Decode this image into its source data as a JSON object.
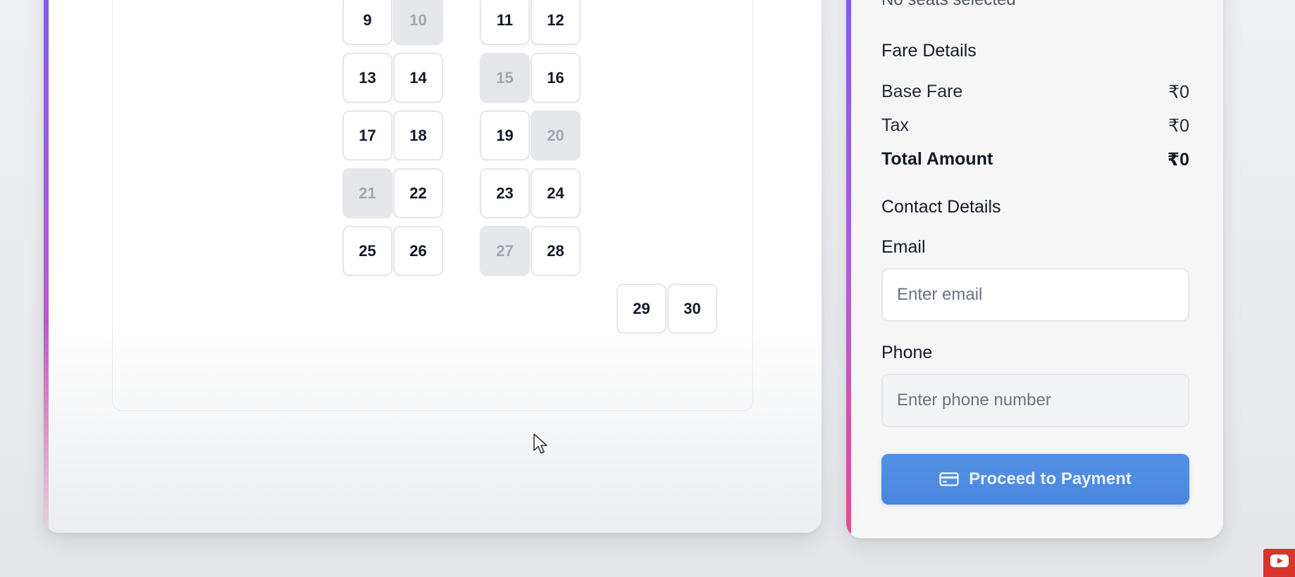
{
  "seat_map": {
    "seats": [
      {
        "number": "",
        "booked": false,
        "col": 0,
        "row": -1
      },
      {
        "number": "",
        "booked": false,
        "col": 1,
        "row": -1
      },
      {
        "number": "",
        "booked": true,
        "col": 2,
        "row": -1
      },
      {
        "number": "",
        "booked": false,
        "col": 3,
        "row": -1
      },
      {
        "number": "9",
        "booked": false,
        "col": 0,
        "row": 0
      },
      {
        "number": "10",
        "booked": true,
        "col": 1,
        "row": 0
      },
      {
        "number": "11",
        "booked": false,
        "col": 2,
        "row": 0
      },
      {
        "number": "12",
        "booked": false,
        "col": 3,
        "row": 0
      },
      {
        "number": "13",
        "booked": false,
        "col": 0,
        "row": 1
      },
      {
        "number": "14",
        "booked": false,
        "col": 1,
        "row": 1
      },
      {
        "number": "15",
        "booked": true,
        "col": 2,
        "row": 1
      },
      {
        "number": "16",
        "booked": false,
        "col": 3,
        "row": 1
      },
      {
        "number": "17",
        "booked": false,
        "col": 0,
        "row": 2
      },
      {
        "number": "18",
        "booked": false,
        "col": 1,
        "row": 2
      },
      {
        "number": "19",
        "booked": false,
        "col": 2,
        "row": 2
      },
      {
        "number": "20",
        "booked": true,
        "col": 3,
        "row": 2
      },
      {
        "number": "21",
        "booked": true,
        "col": 0,
        "row": 3
      },
      {
        "number": "22",
        "booked": false,
        "col": 1,
        "row": 3
      },
      {
        "number": "23",
        "booked": false,
        "col": 2,
        "row": 3
      },
      {
        "number": "24",
        "booked": false,
        "col": 3,
        "row": 3
      },
      {
        "number": "25",
        "booked": false,
        "col": 0,
        "row": 4
      },
      {
        "number": "26",
        "booked": false,
        "col": 1,
        "row": 4
      },
      {
        "number": "27",
        "booked": true,
        "col": 2,
        "row": 4
      },
      {
        "number": "28",
        "booked": false,
        "col": 3,
        "row": 4
      },
      {
        "number": "29",
        "booked": false,
        "col": 4,
        "row": 5
      },
      {
        "number": "30",
        "booked": false,
        "col": 5,
        "row": 5
      }
    ]
  },
  "summary": {
    "selected_text": "No seats selected",
    "fare_title": "Fare Details",
    "fare_rows": [
      {
        "label": "Base Fare",
        "value": "₹0"
      },
      {
        "label": "Tax",
        "value": "₹0"
      },
      {
        "label": "Total Amount",
        "value": "₹0"
      }
    ],
    "contact_title": "Contact Details",
    "email_label": "Email",
    "email_placeholder": "Enter email",
    "email_value": "",
    "phone_label": "Phone",
    "phone_placeholder": "Enter phone number",
    "phone_value": "",
    "pay_button_label": "Proceed to Payment",
    "pay_button_icon": "credit-card-icon"
  },
  "colors": {
    "accent_gradient_top": "#7c5cf0",
    "accent_gradient_bottom": "#e24f8d",
    "pay_button": "#4a86df",
    "booked_seat": "#e5e7eb"
  }
}
